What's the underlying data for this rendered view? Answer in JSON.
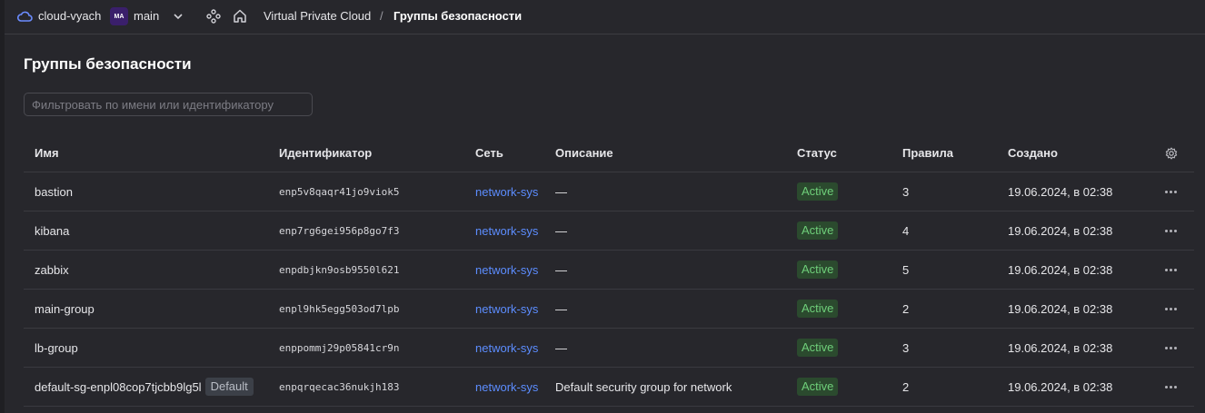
{
  "topbar": {
    "cloud_name": "cloud-vyach",
    "folder_avatar": "MA",
    "folder_name": "main",
    "breadcrumb": [
      "Virtual Private Cloud",
      "Группы безопасности"
    ],
    "separator": "/"
  },
  "page": {
    "title": "Группы безопасности",
    "filter_placeholder": "Фильтровать по имени или идентификатору"
  },
  "table": {
    "columns": [
      "Имя",
      "Идентификатор",
      "Сеть",
      "Описание",
      "Статус",
      "Правила",
      "Создано"
    ],
    "rows": [
      {
        "name": "bastion",
        "default_tag": "",
        "id": "enp5v8qaqr41jo9viok5",
        "network": "network-sys",
        "description": "—",
        "status": "Active",
        "rules": "3",
        "created": "19.06.2024, в 02:38"
      },
      {
        "name": "kibana",
        "default_tag": "",
        "id": "enp7rg6gei956p8go7f3",
        "network": "network-sys",
        "description": "—",
        "status": "Active",
        "rules": "4",
        "created": "19.06.2024, в 02:38"
      },
      {
        "name": "zabbix",
        "default_tag": "",
        "id": "enpdbjkn9osb9550l621",
        "network": "network-sys",
        "description": "—",
        "status": "Active",
        "rules": "5",
        "created": "19.06.2024, в 02:38"
      },
      {
        "name": "main-group",
        "default_tag": "",
        "id": "enpl9hk5egg503od7lpb",
        "network": "network-sys",
        "description": "—",
        "status": "Active",
        "rules": "2",
        "created": "19.06.2024, в 02:38"
      },
      {
        "name": "lb-group",
        "default_tag": "",
        "id": "enppommj29p05841cr9n",
        "network": "network-sys",
        "description": "—",
        "status": "Active",
        "rules": "3",
        "created": "19.06.2024, в 02:38"
      },
      {
        "name": "default-sg-enpl08cop7tjcbb9lg5l",
        "default_tag": "Default",
        "id": "enpqrqecac36nukjh183",
        "network": "network-sys",
        "description": "Default security group for network",
        "status": "Active",
        "rules": "2",
        "created": "19.06.2024, в 02:38"
      }
    ]
  },
  "icons": {
    "cloud": "cloud-icon",
    "chevron": "chevron-down-icon",
    "services": "services-icon",
    "home": "home-icon",
    "settings": "gear-icon",
    "more": "more-icon"
  },
  "colors": {
    "background": "#27272c",
    "link": "#5c8dff",
    "status_active_bg": "#2b4a2e",
    "status_active_text": "#6fcf7a",
    "avatar_bg": "#3a1f6b"
  }
}
